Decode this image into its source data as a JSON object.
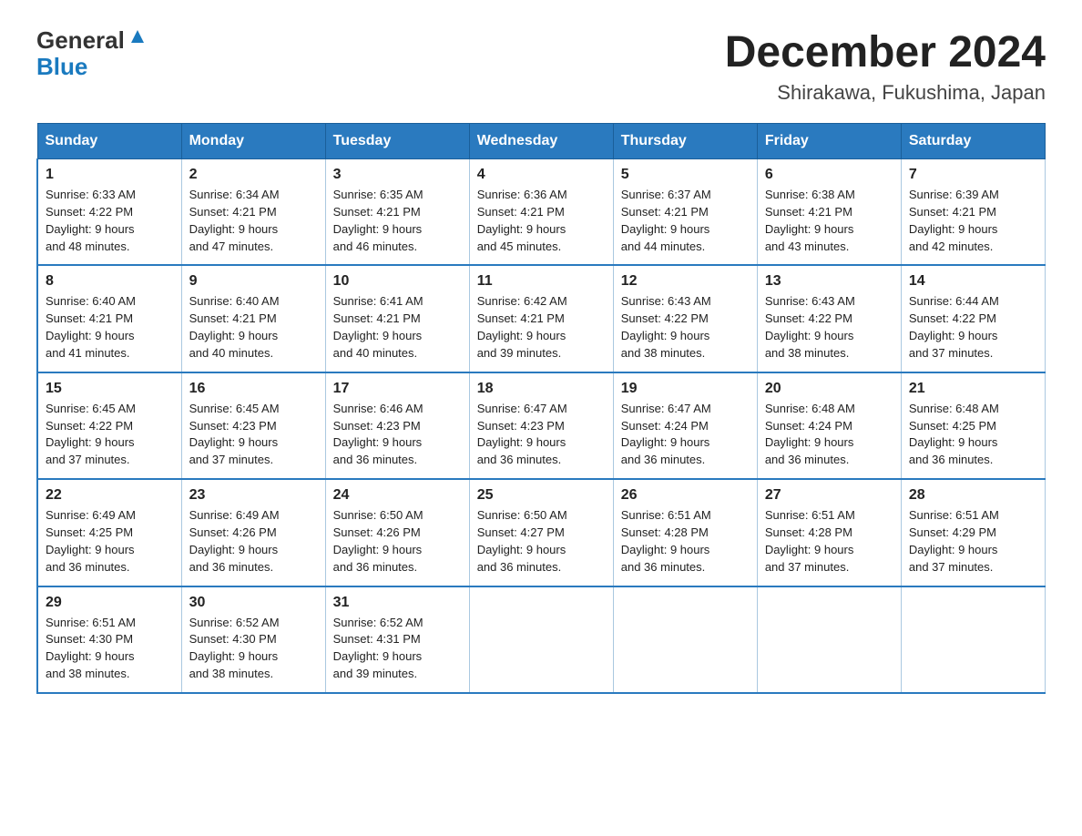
{
  "header": {
    "logo_general": "General",
    "logo_blue": "Blue",
    "month_year": "December 2024",
    "location": "Shirakawa, Fukushima, Japan"
  },
  "days_of_week": [
    "Sunday",
    "Monday",
    "Tuesday",
    "Wednesday",
    "Thursday",
    "Friday",
    "Saturday"
  ],
  "weeks": [
    [
      {
        "day": "1",
        "sunrise": "6:33 AM",
        "sunset": "4:22 PM",
        "daylight": "9 hours and 48 minutes."
      },
      {
        "day": "2",
        "sunrise": "6:34 AM",
        "sunset": "4:21 PM",
        "daylight": "9 hours and 47 minutes."
      },
      {
        "day": "3",
        "sunrise": "6:35 AM",
        "sunset": "4:21 PM",
        "daylight": "9 hours and 46 minutes."
      },
      {
        "day": "4",
        "sunrise": "6:36 AM",
        "sunset": "4:21 PM",
        "daylight": "9 hours and 45 minutes."
      },
      {
        "day": "5",
        "sunrise": "6:37 AM",
        "sunset": "4:21 PM",
        "daylight": "9 hours and 44 minutes."
      },
      {
        "day": "6",
        "sunrise": "6:38 AM",
        "sunset": "4:21 PM",
        "daylight": "9 hours and 43 minutes."
      },
      {
        "day": "7",
        "sunrise": "6:39 AM",
        "sunset": "4:21 PM",
        "daylight": "9 hours and 42 minutes."
      }
    ],
    [
      {
        "day": "8",
        "sunrise": "6:40 AM",
        "sunset": "4:21 PM",
        "daylight": "9 hours and 41 minutes."
      },
      {
        "day": "9",
        "sunrise": "6:40 AM",
        "sunset": "4:21 PM",
        "daylight": "9 hours and 40 minutes."
      },
      {
        "day": "10",
        "sunrise": "6:41 AM",
        "sunset": "4:21 PM",
        "daylight": "9 hours and 40 minutes."
      },
      {
        "day": "11",
        "sunrise": "6:42 AM",
        "sunset": "4:21 PM",
        "daylight": "9 hours and 39 minutes."
      },
      {
        "day": "12",
        "sunrise": "6:43 AM",
        "sunset": "4:22 PM",
        "daylight": "9 hours and 38 minutes."
      },
      {
        "day": "13",
        "sunrise": "6:43 AM",
        "sunset": "4:22 PM",
        "daylight": "9 hours and 38 minutes."
      },
      {
        "day": "14",
        "sunrise": "6:44 AM",
        "sunset": "4:22 PM",
        "daylight": "9 hours and 37 minutes."
      }
    ],
    [
      {
        "day": "15",
        "sunrise": "6:45 AM",
        "sunset": "4:22 PM",
        "daylight": "9 hours and 37 minutes."
      },
      {
        "day": "16",
        "sunrise": "6:45 AM",
        "sunset": "4:23 PM",
        "daylight": "9 hours and 37 minutes."
      },
      {
        "day": "17",
        "sunrise": "6:46 AM",
        "sunset": "4:23 PM",
        "daylight": "9 hours and 36 minutes."
      },
      {
        "day": "18",
        "sunrise": "6:47 AM",
        "sunset": "4:23 PM",
        "daylight": "9 hours and 36 minutes."
      },
      {
        "day": "19",
        "sunrise": "6:47 AM",
        "sunset": "4:24 PM",
        "daylight": "9 hours and 36 minutes."
      },
      {
        "day": "20",
        "sunrise": "6:48 AM",
        "sunset": "4:24 PM",
        "daylight": "9 hours and 36 minutes."
      },
      {
        "day": "21",
        "sunrise": "6:48 AM",
        "sunset": "4:25 PM",
        "daylight": "9 hours and 36 minutes."
      }
    ],
    [
      {
        "day": "22",
        "sunrise": "6:49 AM",
        "sunset": "4:25 PM",
        "daylight": "9 hours and 36 minutes."
      },
      {
        "day": "23",
        "sunrise": "6:49 AM",
        "sunset": "4:26 PM",
        "daylight": "9 hours and 36 minutes."
      },
      {
        "day": "24",
        "sunrise": "6:50 AM",
        "sunset": "4:26 PM",
        "daylight": "9 hours and 36 minutes."
      },
      {
        "day": "25",
        "sunrise": "6:50 AM",
        "sunset": "4:27 PM",
        "daylight": "9 hours and 36 minutes."
      },
      {
        "day": "26",
        "sunrise": "6:51 AM",
        "sunset": "4:28 PM",
        "daylight": "9 hours and 36 minutes."
      },
      {
        "day": "27",
        "sunrise": "6:51 AM",
        "sunset": "4:28 PM",
        "daylight": "9 hours and 37 minutes."
      },
      {
        "day": "28",
        "sunrise": "6:51 AM",
        "sunset": "4:29 PM",
        "daylight": "9 hours and 37 minutes."
      }
    ],
    [
      {
        "day": "29",
        "sunrise": "6:51 AM",
        "sunset": "4:30 PM",
        "daylight": "9 hours and 38 minutes."
      },
      {
        "day": "30",
        "sunrise": "6:52 AM",
        "sunset": "4:30 PM",
        "daylight": "9 hours and 38 minutes."
      },
      {
        "day": "31",
        "sunrise": "6:52 AM",
        "sunset": "4:31 PM",
        "daylight": "9 hours and 39 minutes."
      },
      null,
      null,
      null,
      null
    ]
  ]
}
